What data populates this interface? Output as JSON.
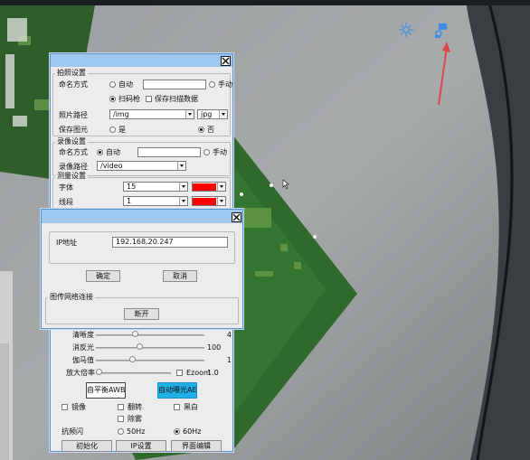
{
  "overlay": {
    "icons": [
      "sun-icon",
      "camera-icon",
      "arrow-annotation"
    ],
    "accent": "#3d8ee6"
  },
  "main_panel": {
    "photo": {
      "group_title": "拍照设置",
      "naming_label": "命名方式",
      "mode_auto": "自动",
      "mode_manual": "手动",
      "mode_scan": "扫码枪",
      "save_scan_data": "保存扫描数据",
      "path_label": "照片路径",
      "path_value": "/img",
      "format_value": "jpg",
      "save_image_label": "保存图元",
      "yes": "是",
      "no": "否"
    },
    "video": {
      "group_title": "录像设置",
      "naming_label": "命名方式",
      "mode_auto": "自动",
      "mode_manual": "手动",
      "path_label": "录像路径",
      "path_value": "/video"
    },
    "measure": {
      "group_title": "测量设置",
      "font_label": "字体",
      "font_value": "15",
      "line_label": "线段",
      "line_value": "1",
      "color": "#ff0000"
    },
    "image": {
      "sharpness_label": "清晰度",
      "sharpness_value": "4",
      "sharpness_level": 0.35,
      "antiglare_label": "消反光",
      "antiglare_value": "100",
      "antiglare_level": 0.4,
      "gamma_label": "伽马值",
      "gamma_value": "1",
      "gamma_level": 0.33,
      "zoom_label": "放大倍率",
      "ezoom_label": "Ezoom",
      "zoom_value": "1.0",
      "zoom_level": 0.0,
      "awb_button": "自平衡AWB",
      "ae_button": "自动曝光AE",
      "ae_color": "#1fb0e8"
    },
    "flags": {
      "mirror": "镜像",
      "flip": "翻转",
      "bw": "黑白",
      "defog": "除雾"
    },
    "flicker": {
      "label": "抗频闪",
      "hz50": "50Hz",
      "hz60": "60Hz"
    },
    "footer": {
      "init": "初始化",
      "ip": "IP设置",
      "ui_edit": "界面编辑"
    }
  },
  "ip_dialog": {
    "ip_label": "IP地址",
    "ip_value": "192.168.20.247",
    "ok": "确定",
    "cancel": "取消",
    "net_group_title": "图传网络连接",
    "disconnect": "断开"
  }
}
